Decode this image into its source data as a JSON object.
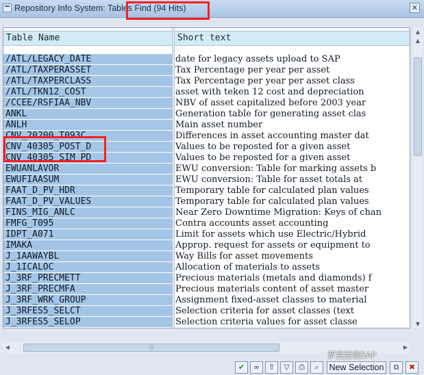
{
  "window": {
    "title": "Repository Info System: Tables Find (94 Hits)",
    "close_glyph": "✕"
  },
  "table": {
    "columns": [
      "Table Name",
      "Short text"
    ],
    "rows": [
      {
        "name": "/ATL/LEGACY_DATE",
        "text": "date for legacy assets upload to SAP"
      },
      {
        "name": "/ATL/TAXPERASSET",
        "text": "Tax Percentage per year per asset"
      },
      {
        "name": "/ATL/TAXPERCLASS",
        "text": "Tax Percentage per year per asset class"
      },
      {
        "name": "/ATL/TKN12_COST",
        "text": "asset with teken 12 cost and depreciation"
      },
      {
        "name": "/CCEE/RSFIAA_NBV",
        "text": "NBV of asset capitalized before 2003 year"
      },
      {
        "name": "ANKL",
        "text": "Generation table for generating asset clas"
      },
      {
        "name": "ANLH",
        "text": "Main asset number"
      },
      {
        "name": "CNV_20200_T093C",
        "text": "Differences in asset accounting master dat"
      },
      {
        "name": "CNV_40305_POST_D",
        "text": "Values to be reposted for a given asset"
      },
      {
        "name": "CNV_40305_SIM_PD",
        "text": "Values to be reposted for a given asset"
      },
      {
        "name": "EWUANLAVOR",
        "text": "EWU conversion: Table for marking assets b"
      },
      {
        "name": "EWUFIAASUM",
        "text": "EWU conversion: Table for asset totals at"
      },
      {
        "name": "FAAT_D_PV_HDR",
        "text": "Temporary table for calculated plan values"
      },
      {
        "name": "FAAT_D_PV_VALUES",
        "text": "Temporary table for calculated plan values"
      },
      {
        "name": "FINS_MIG_ANLC",
        "text": "Near Zero Downtime Migration: Keys of chan"
      },
      {
        "name": "FMFG_T095",
        "text": "Contra accounts asset accounting"
      },
      {
        "name": "IDPT_A071",
        "text": "Limit for assets which use Electric/Hybrid"
      },
      {
        "name": "IMAKA",
        "text": "Approp. request for assets or equipment to"
      },
      {
        "name": "J_1AAWAYBL",
        "text": "Way Bills for asset movements"
      },
      {
        "name": "J_1ICALOC",
        "text": "Allocation of materials to assets"
      },
      {
        "name": "J_3RF_PRECMETT",
        "text": "Precious materials (metals and diamonds) f"
      },
      {
        "name": "J_3RF_PRECMFA",
        "text": "Precious materials content of asset master"
      },
      {
        "name": "J_3RF_WRK_GROUP",
        "text": "Assignment fixed-asset classes to material"
      },
      {
        "name": "J_3RFES5_SELCT",
        "text": "Selection criteria for asset classes (text"
      },
      {
        "name": "J_3RFES5_SELOP",
        "text": "Selection criteria values for asset classe"
      }
    ]
  },
  "scroll": {
    "up_glyph": "▲",
    "up2_glyph": "▲",
    "down_glyph": "▼",
    "left_glyph": "◀",
    "right_glyph": "▶",
    "hthumb_grip": "⁞⁞⁞"
  },
  "toolbar": {
    "buttons": [
      {
        "icon": "checkmark-icon",
        "glyph": "✔"
      },
      {
        "icon": "binoculars-icon",
        "glyph": "∞"
      },
      {
        "icon": "sort-ascending-icon",
        "glyph": "⇧"
      },
      {
        "icon": "filter-icon",
        "glyph": "▽"
      },
      {
        "icon": "print-icon",
        "glyph": "⎙"
      },
      {
        "icon": "find-icon",
        "glyph": "⌕"
      }
    ],
    "new_selection_label": "New Selection",
    "copy_glyph": "⧉",
    "cancel_glyph": "✖"
  },
  "watermark": {
    "text": "罗克西谈SAP"
  },
  "colors": {
    "highlight": "#ff1e1e",
    "selected_cell": "#a4c5e6",
    "header": "#d3ebf7"
  }
}
